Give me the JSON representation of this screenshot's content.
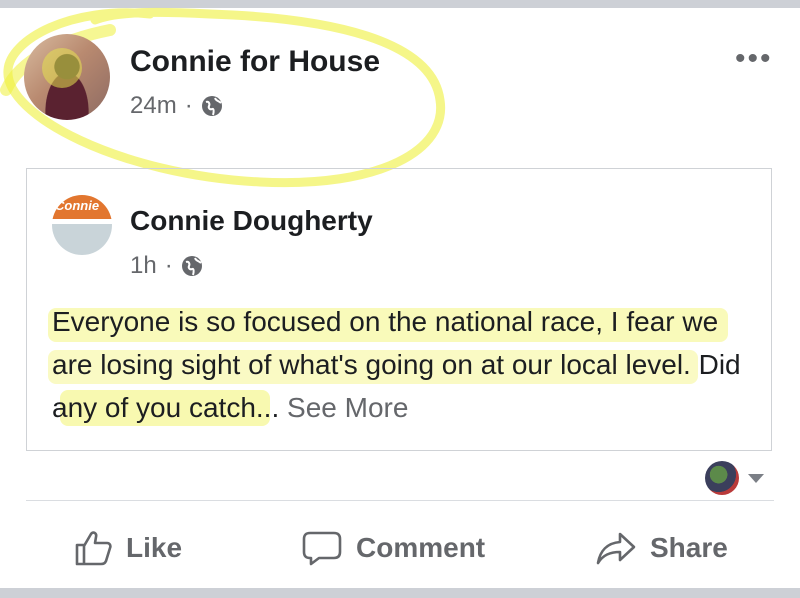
{
  "post": {
    "page_name": "Connie for House",
    "time": "24m",
    "dot": "·",
    "more_label": "•••"
  },
  "shared_post": {
    "avatar_text": "Connie",
    "author": "Connie Dougherty",
    "time": "1h",
    "dot": "·",
    "text": "Everyone is so focused on the national race, I fear we are losing sight of what's going on at our local level. Did any of you catch...",
    "see_more": "See More"
  },
  "actions": {
    "like": "Like",
    "comment": "Comment",
    "share": "Share"
  },
  "colors": {
    "highlight": "#eef03a",
    "secondary_text": "#65676b",
    "primary_text": "#1c1e21"
  }
}
